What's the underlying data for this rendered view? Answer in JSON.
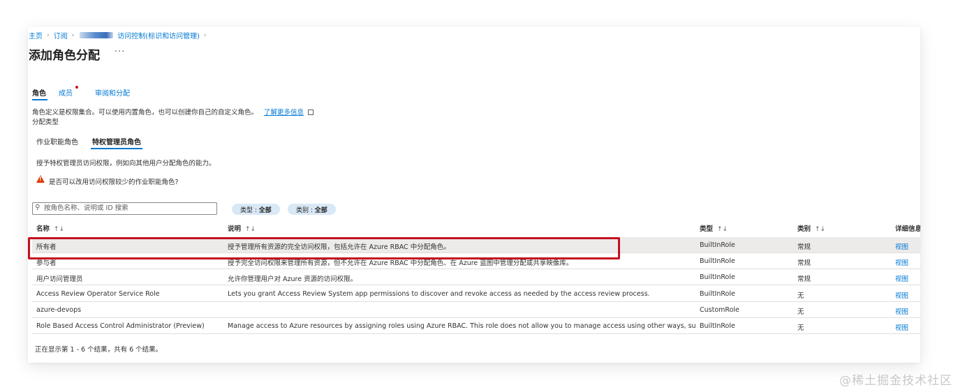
{
  "breadcrumb": {
    "home": "主页",
    "subscription": "订阅",
    "access_control": "访问控制(标识和访问管理)"
  },
  "page": {
    "title": "添加角色分配",
    "more": "···"
  },
  "tabs": [
    "角色",
    "成员",
    "审阅和分配"
  ],
  "description": {
    "text": "角色定义是权限集合。可以使用内置角色，也可以创建你自己的自定义角色。",
    "learn_more": "了解更多信息"
  },
  "assignment_type_label": "分配类型",
  "subtabs": [
    "作业职能角色",
    "特权管理员角色"
  ],
  "hint": "授予特权管理员访问权限，例如向其他用户分配角色的能力。",
  "warning": "是否可以改用访问权限较少的作业职能角色?",
  "search": {
    "placeholder": "按角色名称、说明或 ID 搜索"
  },
  "filters": {
    "type": {
      "label": "类型 : ",
      "value": "全部"
    },
    "category": {
      "label": "类别 : ",
      "value": "全部"
    }
  },
  "columns": {
    "name": "名称",
    "description": "说明",
    "type": "类型",
    "category": "类别",
    "details": "详细信息",
    "sort": "↑↓"
  },
  "rows": [
    {
      "name": "所有者",
      "description": "授予管理所有资源的完全访问权限，包括允许在 Azure RBAC 中分配角色。",
      "type": "BuiltInRole",
      "category": "常规",
      "view": "视图"
    },
    {
      "name": "参与者",
      "description": "授予完全访问权限来管理所有资源，但不允许在 Azure RBAC 中分配角色、在 Azure 蓝图中管理分配或共享映像库。",
      "type": "BuiltInRole",
      "category": "常规",
      "view": "视图"
    },
    {
      "name": "用户访问管理员",
      "description": "允许你管理用户对 Azure 资源的访问权限。",
      "type": "BuiltInRole",
      "category": "常规",
      "view": "视图"
    },
    {
      "name": "Access Review Operator Service Role",
      "description": "Lets you grant Access Review System app permissions to discover and revoke access as needed by the access review process.",
      "type": "BuiltInRole",
      "category": "无",
      "view": "视图"
    },
    {
      "name": "azure-devops",
      "description": "",
      "type": "CustomRole",
      "category": "无",
      "view": "视图"
    },
    {
      "name": "Role Based Access Control Administrator (Preview)",
      "description": "Manage access to Azure resources by assigning roles using Azure RBAC. This role does not allow you to manage access using other ways, such as Azure Policy.",
      "type": "BuiltInRole",
      "category": "无",
      "view": "视图"
    }
  ],
  "footer": "正在显示第 1 - 6 个结果，共有 6 个结果。",
  "watermark": "@稀土掘金技术社区",
  "colors": {
    "accent": "#0078d4",
    "highlight_border": "#c50f1f",
    "warning": "#d83b01",
    "selected_row": "#ecebea"
  }
}
